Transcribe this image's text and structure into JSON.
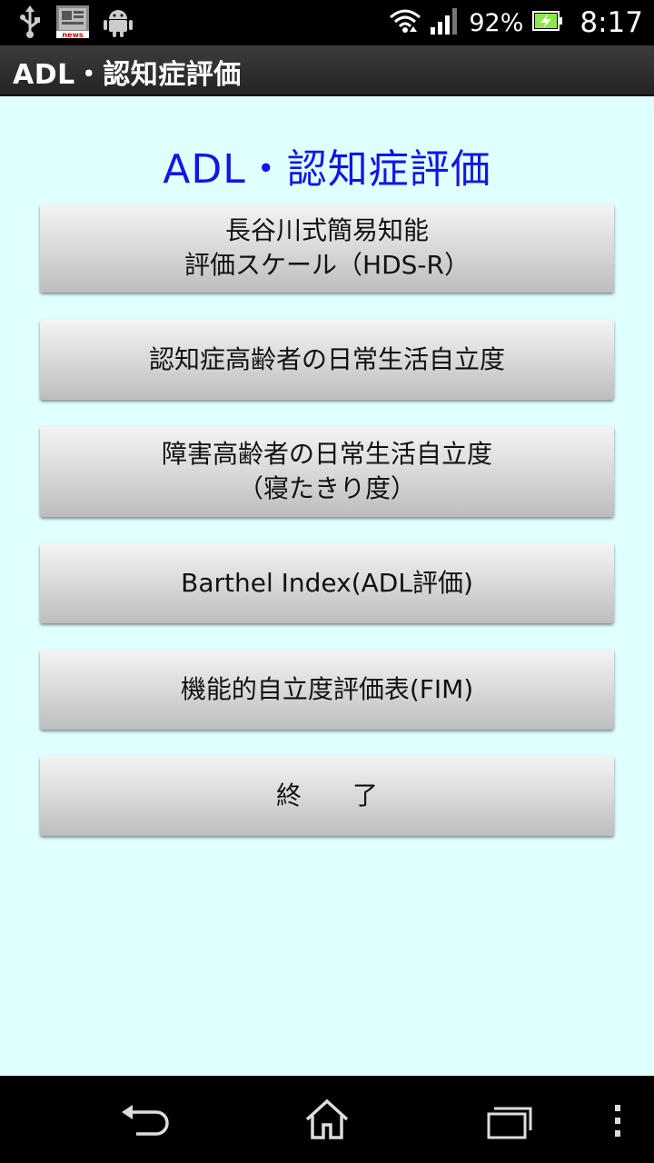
{
  "status_bar": {
    "icons": [
      "usb-icon",
      "news-tv-app-icon",
      "android-debug-icon",
      "wifi-icon",
      "signal-icon",
      "battery-charging-icon"
    ],
    "battery_percent": "92%",
    "time": "8:17"
  },
  "action_bar": {
    "title": "ADL・認知症評価"
  },
  "main": {
    "heading": "ADL・認知症評価",
    "buttons": [
      {
        "line1": "長谷川式簡易知能",
        "line2": "評価スケール（HDS-R）"
      },
      {
        "line1": "認知症高齢者の日常生活自立度"
      },
      {
        "line1": "障害高齢者の日常生活自立度",
        "line2": "（寝たきり度）"
      },
      {
        "line1": "Barthel Index(ADL評価)"
      },
      {
        "line1": "機能的自立度評価表(FIM)"
      },
      {
        "line1": "終　　了"
      }
    ]
  },
  "nav_bar": {
    "icons": [
      "back-icon",
      "home-icon",
      "recent-apps-icon",
      "overflow-menu-icon"
    ]
  },
  "colors": {
    "content_background": "#e0ffff",
    "heading": "#1414e6",
    "action_bar": "#303030"
  }
}
